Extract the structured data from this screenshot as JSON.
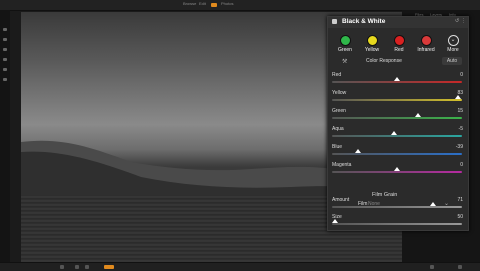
{
  "app": {
    "top_tabs": [
      "Browse",
      "Edit",
      "Photos"
    ],
    "right_tabs": [
      "Files",
      "Layers",
      "Info"
    ]
  },
  "panel": {
    "title": "Black & White",
    "swatches": [
      {
        "label": "Green",
        "color": "#2fb84a"
      },
      {
        "label": "Yellow",
        "color": "#e7d91e"
      },
      {
        "label": "Red",
        "color": "#d92121"
      },
      {
        "label": "Infrared",
        "color": "#d93a3a"
      },
      {
        "label": "More",
        "color": "#2b2b2b"
      }
    ],
    "color_response_label": "Color Response",
    "auto_label": "Auto",
    "sliders": [
      {
        "label": "Red",
        "value": "0",
        "fraction": 0.5,
        "track": "linear-gradient(90deg,#555,#c62828)"
      },
      {
        "label": "Yellow",
        "value": "83",
        "fraction": 0.97,
        "track": "linear-gradient(90deg,#555,#d4c12b)"
      },
      {
        "label": "Green",
        "value": "15",
        "fraction": 0.66,
        "track": "linear-gradient(90deg,#555,#3bb34a)"
      },
      {
        "label": "Aqua",
        "value": "-5",
        "fraction": 0.48,
        "track": "linear-gradient(90deg,#555,#2aa6a0)"
      },
      {
        "label": "Blue",
        "value": "-39",
        "fraction": 0.2,
        "track": "linear-gradient(90deg,#555,#2a6fc9)"
      },
      {
        "label": "Magenta",
        "value": "0",
        "fraction": 0.5,
        "track": "linear-gradient(90deg,#555,#b62aa1)"
      }
    ],
    "film_grain_label": "Film Grain",
    "film_label": "Film",
    "film_value": "None",
    "grain_sliders": [
      {
        "label": "Amount",
        "value": "71",
        "fraction": 0.78,
        "track": "linear-gradient(90deg,#555,#999)"
      },
      {
        "label": "Size",
        "value": "50",
        "fraction": 0.02,
        "track": "linear-gradient(90deg,#555,#999)"
      }
    ]
  }
}
